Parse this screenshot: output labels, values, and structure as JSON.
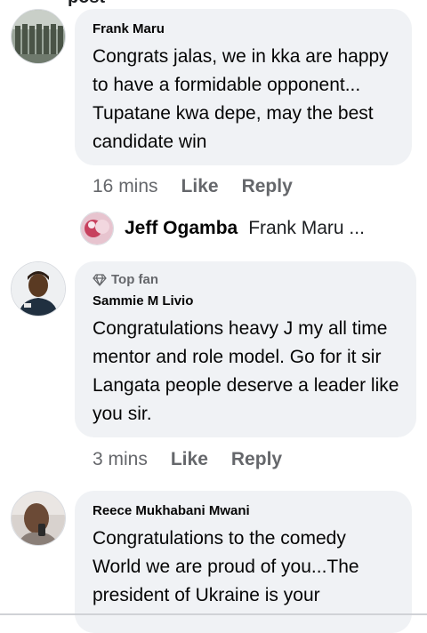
{
  "header_cut": "post",
  "comments": [
    {
      "author": "Frank Maru",
      "text": "Congrats jalas, we in kka are happy to have a formidable opponent... Tupatane kwa depe, may the best candidate win",
      "time": "16 mins",
      "like": "Like",
      "reply": "Reply"
    },
    {
      "badge": "Top fan",
      "author": "Sammie M Livio",
      "text": "Congratulations heavy J my all time mentor and role model. Go for it sir Langata people deserve a leader like you sir.",
      "time": "3 mins",
      "like": "Like",
      "reply": "Reply"
    },
    {
      "author": "Reece Mukhabani Mwani",
      "text": "Congratulations  to the comedy World we are proud of you...The president of Ukraine is your"
    }
  ],
  "reply_preview": {
    "name": "Jeff Ogamba",
    "text": "Frank Maru ..."
  },
  "colors": {
    "bubble": "#f0f2f5",
    "meta": "#65676b"
  }
}
